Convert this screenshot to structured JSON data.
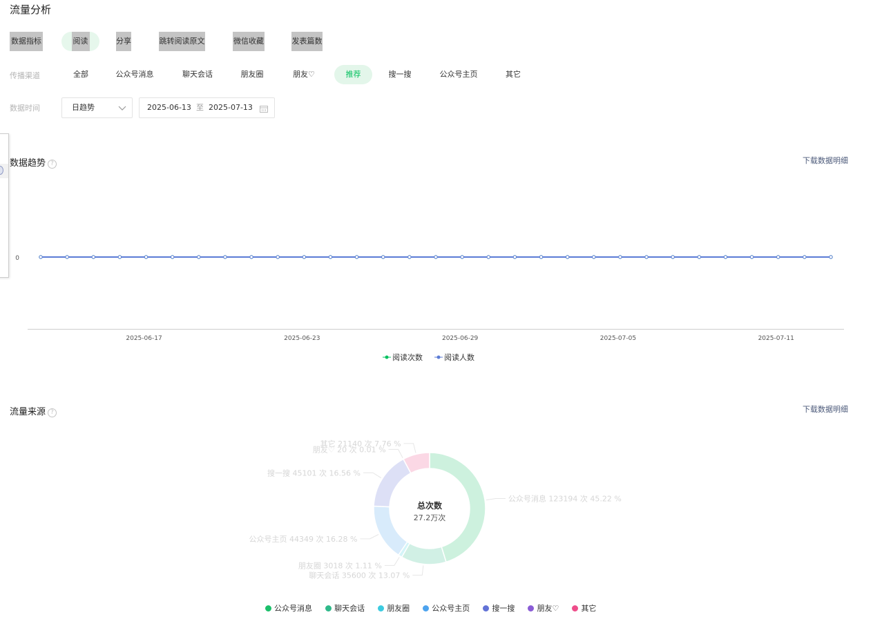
{
  "page": {
    "title": "流量分析"
  },
  "metrics": {
    "label": "数据指标",
    "items": [
      {
        "label": "阅读",
        "active": true
      },
      {
        "label": "分享"
      },
      {
        "label": "跳转阅读原文"
      },
      {
        "label": "微信收藏"
      },
      {
        "label": "发表篇数"
      }
    ]
  },
  "channels": {
    "label": "传播渠道",
    "items": [
      {
        "label": "全部"
      },
      {
        "label": "公众号消息"
      },
      {
        "label": "聊天会话"
      },
      {
        "label": "朋友圈"
      },
      {
        "label": "朋友♡"
      },
      {
        "label": "推荐",
        "active": true
      },
      {
        "label": "搜一搜"
      },
      {
        "label": "公众号主页"
      },
      {
        "label": "其它"
      }
    ]
  },
  "time": {
    "label": "数据时间",
    "mode": "日趋势",
    "start": "2025-06-13",
    "sep": "至",
    "end": "2025-07-13"
  },
  "side_panel": {
    "text": ")"
  },
  "trend": {
    "title": "数据趋势",
    "help": "?",
    "download": "下载数据明细"
  },
  "source": {
    "title": "流量来源",
    "help": "?",
    "download": "下载数据明细",
    "center_title": "总次数",
    "center_value": "27.2万次"
  },
  "colors": {
    "accent": "#07c160",
    "line": "#5b7bd5",
    "channel_colors": [
      "#1bbf6a",
      "#2fb98a",
      "#3ccbe0",
      "#4da3ee",
      "#6272d6",
      "#8a5cd6",
      "#ee4d8a"
    ]
  },
  "chart_data": [
    {
      "type": "line",
      "x": [
        "2025-06-13",
        "2025-06-14",
        "2025-06-15",
        "2025-06-16",
        "2025-06-17",
        "2025-06-18",
        "2025-06-19",
        "2025-06-20",
        "2025-06-21",
        "2025-06-22",
        "2025-06-23",
        "2025-06-24",
        "2025-06-25",
        "2025-06-26",
        "2025-06-27",
        "2025-06-28",
        "2025-06-29",
        "2025-06-30",
        "2025-07-01",
        "2025-07-02",
        "2025-07-03",
        "2025-07-04",
        "2025-07-05",
        "2025-07-06",
        "2025-07-07",
        "2025-07-08",
        "2025-07-09",
        "2025-07-10",
        "2025-07-11",
        "2025-07-12",
        "2025-07-13"
      ],
      "x_ticks": [
        "2025-06-17",
        "2025-06-23",
        "2025-06-29",
        "2025-07-05",
        "2025-07-11"
      ],
      "y_ticks": [
        "0"
      ],
      "series": [
        {
          "name": "阅读次数",
          "color": "#07c160",
          "values": [
            0,
            0,
            0,
            0,
            0,
            0,
            0,
            0,
            0,
            0,
            0,
            0,
            0,
            0,
            0,
            0,
            0,
            0,
            0,
            0,
            0,
            0,
            0,
            0,
            0,
            0,
            0,
            0,
            0,
            0,
            0
          ]
        },
        {
          "name": "阅读人数",
          "color": "#5b7bd5",
          "values": [
            0,
            0,
            0,
            0,
            0,
            0,
            0,
            0,
            0,
            0,
            0,
            0,
            0,
            0,
            0,
            0,
            0,
            0,
            0,
            0,
            0,
            0,
            0,
            0,
            0,
            0,
            0,
            0,
            0,
            0,
            0
          ]
        }
      ],
      "grid": false,
      "legend": "bottom"
    },
    {
      "type": "pie",
      "title": "总次数",
      "labels": [
        "公众号消息",
        "聊天会话",
        "朋友圈",
        "公众号主页",
        "搜一搜",
        "朋友♡",
        "其它"
      ],
      "values": [
        123194,
        35600,
        3018,
        44349,
        45101,
        20,
        21140
      ],
      "percents": [
        45.22,
        13.07,
        1.11,
        16.28,
        16.56,
        0.01,
        7.76
      ],
      "colors": [
        "#1bbf6a",
        "#2fb98a",
        "#3ccbe0",
        "#4da3ee",
        "#6272d6",
        "#8a5cd6",
        "#ee4d8a"
      ],
      "slice_labels": [
        "公众号消息 123194 次 45.22 %",
        "聊天会话 35600 次 13.07 %",
        "朋友圈 3018 次 1.11 %",
        "公众号主页 44349 次 16.28 %",
        "搜一搜 45101 次 16.56 %",
        "朋友♡ 20 次 0.01 %",
        "其它 21140 次 7.76 %"
      ],
      "legend": "bottom"
    }
  ]
}
